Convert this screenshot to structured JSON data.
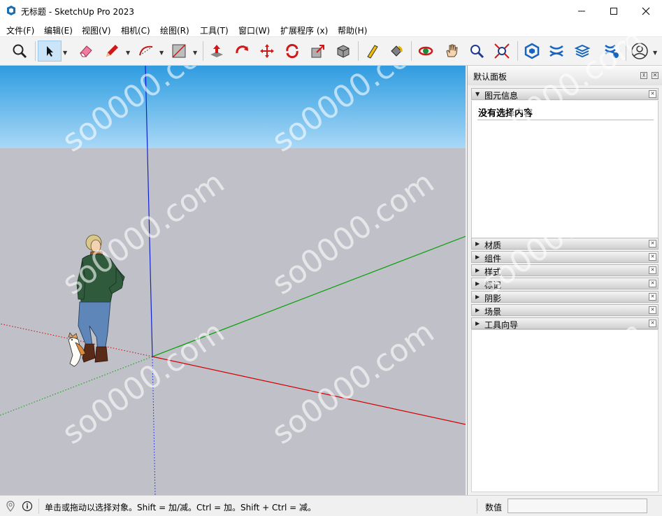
{
  "window": {
    "title": "无标题 - SketchUp Pro 2023",
    "app_icon": "sketchup-logo-icon",
    "controls": [
      "minimize-icon",
      "maximize-icon",
      "close-icon"
    ]
  },
  "menu": {
    "items": [
      "文件(F)",
      "编辑(E)",
      "视图(V)",
      "相机(C)",
      "绘图(R)",
      "工具(T)",
      "窗口(W)",
      "扩展程序 (x)",
      "帮助(H)"
    ]
  },
  "toolbar": {
    "tools": [
      {
        "name": "search-icon"
      },
      {
        "name": "select-arrow-icon",
        "active": true
      },
      {
        "name": "eraser-icon"
      },
      {
        "name": "pencil-line-icon"
      },
      {
        "name": "arc-icon"
      },
      {
        "name": "rectangle-icon"
      },
      {
        "name": "push-pull-icon"
      },
      {
        "name": "rotate-icon"
      },
      {
        "name": "move-icon"
      },
      {
        "name": "follow-me-icon"
      },
      {
        "name": "scale-icon"
      },
      {
        "name": "offset-icon"
      },
      {
        "name": "tape-measure-icon"
      },
      {
        "name": "paint-bucket-icon"
      },
      {
        "name": "orbit-icon"
      },
      {
        "name": "pan-hand-icon"
      },
      {
        "name": "zoom-icon"
      },
      {
        "name": "zoom-extents-icon"
      },
      {
        "name": "3d-warehouse-icon"
      },
      {
        "name": "extension-warehouse-icon"
      },
      {
        "name": "layout-send-icon"
      },
      {
        "name": "extension-manager-icon"
      },
      {
        "name": "user-account-icon"
      }
    ]
  },
  "watermark": "so0000.com",
  "panel": {
    "title": "默认面板",
    "entity_info": {
      "label": "图元信息",
      "content": "没有选择内容"
    },
    "trays": [
      "材质",
      "组件",
      "样式",
      "标记",
      "阴影",
      "场景",
      "工具向导"
    ]
  },
  "status": {
    "message": "单击或拖动以选择对象。Shift = 加/减。Ctrl = 加。Shift + Ctrl = 减。",
    "value_label": "数值",
    "value": ""
  },
  "colors": {
    "x_axis": "#d40000",
    "y_axis": "#00a000",
    "z_axis": "#1020d0",
    "sky": "#6cbbec",
    "ground": "#c0c0c8"
  }
}
